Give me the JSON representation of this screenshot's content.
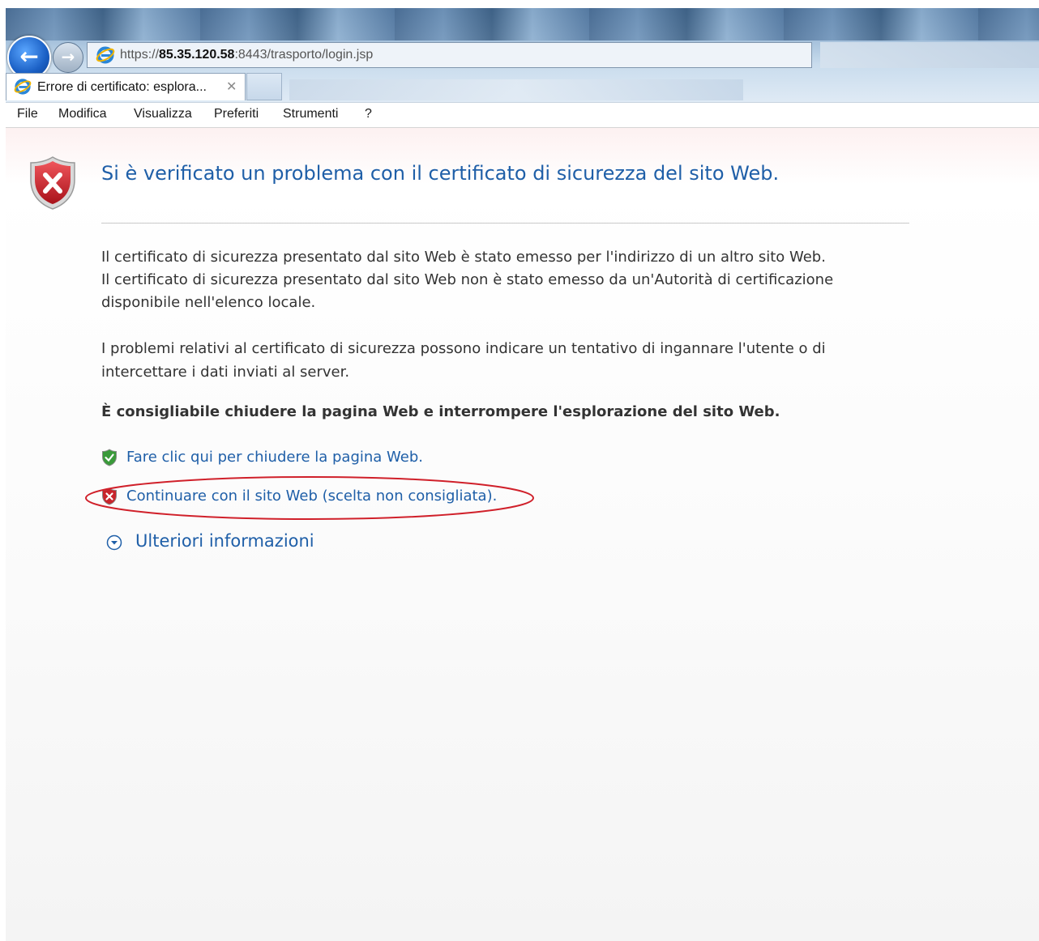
{
  "browser": {
    "address": {
      "scheme": "https://",
      "host": "85.35.120.58",
      "rest": ":8443/trasporto/login.jsp"
    },
    "back_icon": "back-arrow-icon",
    "forward_icon": "forward-arrow-icon",
    "tab": {
      "title": "Errore di certificato: esplora...",
      "close_glyph": "✕",
      "icon": "internet-explorer-icon"
    },
    "menu": [
      "File",
      "Modifica",
      "Visualizza",
      "Preferiti",
      "Strumenti",
      "?"
    ]
  },
  "page": {
    "shield_icon": "security-error-shield-icon",
    "heading": "Si è verificato un problema con il certificato di sicurezza del sito Web.",
    "paragraph1": [
      "Il certificato di sicurezza presentato dal sito Web è stato emesso per l'indirizzo di un altro sito Web.",
      "Il certificato di sicurezza presentato dal sito Web non è stato emesso da un'Autorità di certificazione",
      "disponibile nell'elenco locale."
    ],
    "paragraph2": [
      "I problemi relativi al certificato di sicurezza possono indicare un tentativo di ingannare l'utente o di",
      "intercettare i dati inviati al server."
    ],
    "advice": "È consigliabile chiudere la pagina Web e interrompere l'esplorazione del sito Web.",
    "actions": [
      {
        "label": "Fare clic qui per chiudere la pagina Web.",
        "icon": "green-shield-check-icon"
      },
      {
        "label": "Continuare con il sito Web (scelta non consigliata).",
        "icon": "red-shield-x-icon"
      }
    ],
    "more_info": "Ulteriori informazioni",
    "more_info_icon": "chevron-down-circle-icon"
  },
  "colors": {
    "link": "#1f5fa8",
    "annotation": "#d0202a",
    "error_red": "#c8242c",
    "safe_green": "#3a9a3a"
  }
}
